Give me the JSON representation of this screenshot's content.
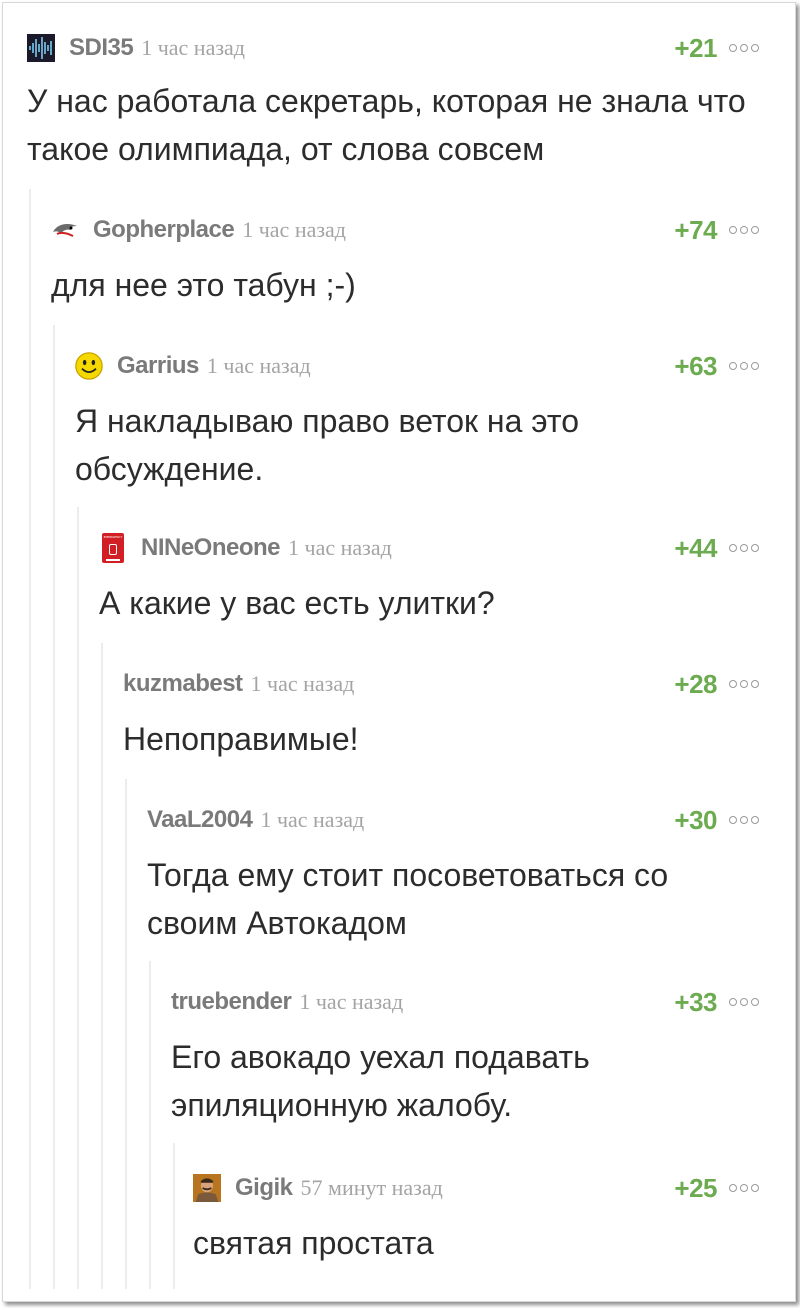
{
  "comments": [
    {
      "author": "SDI35",
      "time": "1 час назад",
      "rating": "+21",
      "text": "У нас работала секретарь, которая не знала что такое олимпиада, от слова совсем",
      "avatar": "waveform-avatar"
    },
    {
      "author": "Gopherplace",
      "time": "1 час назад",
      "rating": "+74",
      "text": "для нее это табун ;-)",
      "avatar": "eagle-avatar"
    },
    {
      "author": "Garrius",
      "time": "1 час назад",
      "rating": "+63",
      "text": "Я накладываю право веток на это обсуждение.",
      "avatar": "smiley-avatar"
    },
    {
      "author": "NINeOneone",
      "time": "1 час назад",
      "rating": "+44",
      "text": "А какие у вас есть улитки?",
      "avatar": "emergency-sign-avatar",
      "avatar_text": "EMERGENCY"
    },
    {
      "author": "kuzmabest",
      "time": "1 час назад",
      "rating": "+28",
      "text": "Непоправимые!",
      "avatar": ""
    },
    {
      "author": "VaaL2004",
      "time": "1 час назад",
      "rating": "+30",
      "text": "Тогда ему стоит посоветоваться со своим Автокадом",
      "avatar": ""
    },
    {
      "author": "truebender",
      "time": "1 час назад",
      "rating": "+33",
      "text": "Его авокадо уехал подавать эпиляционную жалобу.",
      "avatar": ""
    },
    {
      "author": "Gigik",
      "time": "57 минут назад",
      "rating": "+25",
      "text": "святая простата",
      "avatar": "portrait-avatar"
    }
  ],
  "colors": {
    "rating": "#6cab4f",
    "author": "#7a7a7a",
    "time": "#a4a4a4",
    "text": "#2c2c2c",
    "thread_line": "#ececec"
  }
}
